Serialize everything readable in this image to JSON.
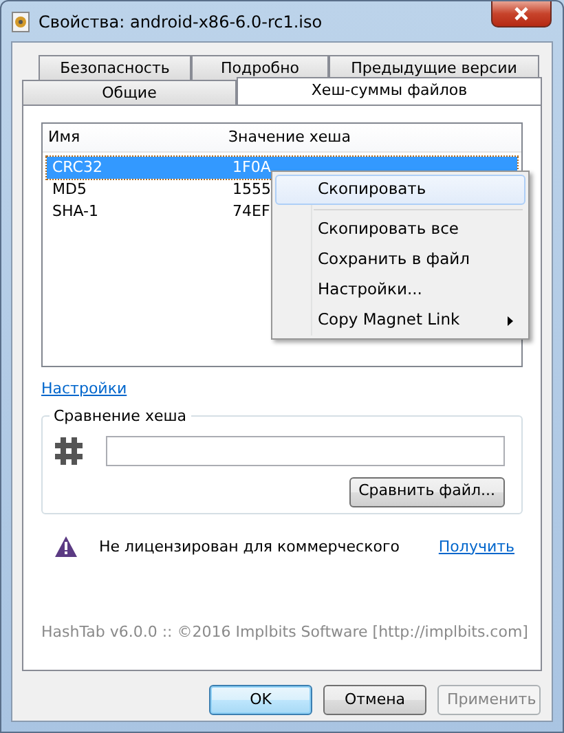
{
  "window": {
    "title": "Свойства: android-x86-6.0-rc1.iso"
  },
  "tab_rows": [
    [
      {
        "label": "Безопасность",
        "selected": false
      },
      {
        "label": "Подробно",
        "selected": false
      },
      {
        "label": "Предыдущие версии",
        "selected": false
      }
    ],
    [
      {
        "label": "Общие",
        "selected": false
      },
      {
        "label": "Хеш-суммы файлов",
        "selected": true
      }
    ]
  ],
  "hash_table": {
    "columns": [
      "Имя",
      "Значение хеша"
    ],
    "rows": [
      {
        "name": "CRC32",
        "value": "1F0A",
        "selected": true
      },
      {
        "name": "MD5",
        "value": "1555",
        "selected": false
      },
      {
        "name": "SHA-1",
        "value": "74EF",
        "selected": false
      }
    ]
  },
  "context_menu": [
    {
      "label": "Скопировать",
      "kind": "item",
      "highlighted": true
    },
    {
      "kind": "separator"
    },
    {
      "label": "Скопировать все",
      "kind": "item",
      "highlighted": false
    },
    {
      "label": "Сохранить в файл",
      "kind": "item",
      "highlighted": false
    },
    {
      "label": "Настройки...",
      "kind": "item",
      "highlighted": false
    },
    {
      "label": "Copy Magnet Link",
      "kind": "submenu",
      "highlighted": false
    }
  ],
  "settings_link": "Настройки",
  "hash_compare": {
    "title": "Сравнение хеша",
    "button": "Сравнить файл..."
  },
  "license": {
    "message": "Не лицензирован для коммерческого",
    "link": "Получить"
  },
  "footer": "HashTab v6.0.0 :: ©2016 Implbits Software [http://implbits.com]",
  "buttons": [
    {
      "label": "OK",
      "kind": "default",
      "disabled": false
    },
    {
      "label": "Отмена",
      "kind": "normal",
      "disabled": false
    },
    {
      "label": "Применить",
      "kind": "normal",
      "disabled": true
    }
  ]
}
